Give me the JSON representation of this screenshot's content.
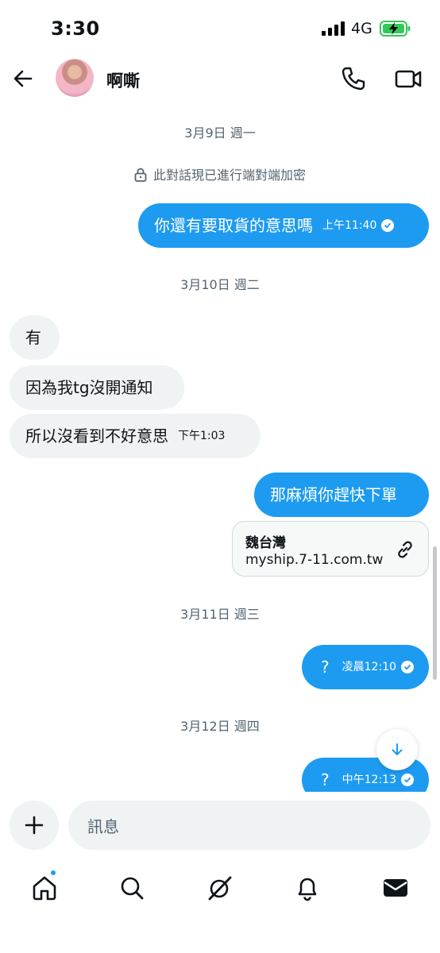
{
  "status_bar": {
    "time": "3:30",
    "network": "4G"
  },
  "header": {
    "contact_name": "啊嘶"
  },
  "encryption_note": "此對話現已進行端對端加密",
  "dates": {
    "d1": "3月9日 週一",
    "d2": "3月10日 週二",
    "d3": "3月11日 週三",
    "d4": "3月12日 週四"
  },
  "messages": [
    {
      "text": "你還有要取貨的意思嗎",
      "time": "上午11:40"
    },
    {
      "text": "有"
    },
    {
      "text": "因為我tg沒開通知"
    },
    {
      "text": "所以沒看到不好意思",
      "time": "下午1:03"
    },
    {
      "text": "那麻煩你趕快下單"
    },
    {
      "text": "?",
      "time": "凌晨12:10"
    },
    {
      "text": "?",
      "time": "中午12:13"
    }
  ],
  "link_card": {
    "title": "魏台灣",
    "url": "myship.7-11.com.tw"
  },
  "composer": {
    "placeholder": "訊息"
  },
  "colors": {
    "accent": "#1d9bf0",
    "incoming_bubble": "#eff3f4",
    "muted_text": "#536471"
  },
  "icons": [
    "back-arrow-icon",
    "phone-icon",
    "video-icon",
    "lock-icon",
    "check-circle-icon",
    "link-icon",
    "arrow-down-icon",
    "plus-icon",
    "home-icon",
    "search-icon",
    "grok-icon",
    "bell-icon",
    "mail-icon"
  ]
}
